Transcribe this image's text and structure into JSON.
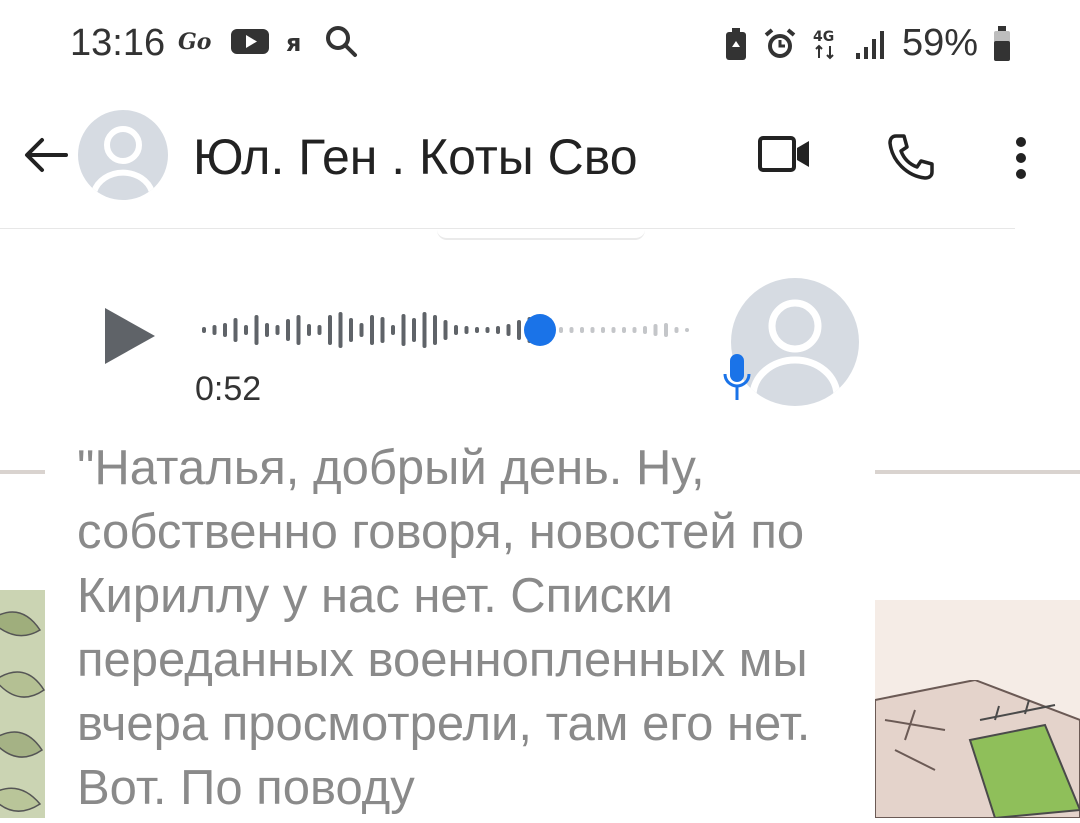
{
  "status_bar": {
    "time": "13:16",
    "battery_percent": "59%",
    "network": "4G",
    "left_icons": [
      "go-icon",
      "youtube-icon",
      "yandex-icon",
      "search-icon"
    ],
    "right_icons": [
      "battery-saver-icon",
      "alarm-icon",
      "network-4g-icon",
      "signal-icon",
      "battery-icon"
    ]
  },
  "header": {
    "title": "Юл. Ген . Коты Сво",
    "icons": [
      "back-arrow-icon",
      "video-call-icon",
      "phone-icon",
      "more-vert-icon"
    ]
  },
  "message": {
    "duration": "0:52",
    "progress": 0.62,
    "transcript": "\"Наталья, добрый день. Ну, собственно говоря, новостей по Кириллу у нас нет. Списки переданных военнопленных мы вчера просмотрели, там его нет. Вот. По поводу"
  },
  "colors": {
    "accent": "#1a73e8",
    "icon_gray": "#5f6368",
    "avatar_bg": "#d6dbe2",
    "transcript_text": "#8a8a8a"
  }
}
